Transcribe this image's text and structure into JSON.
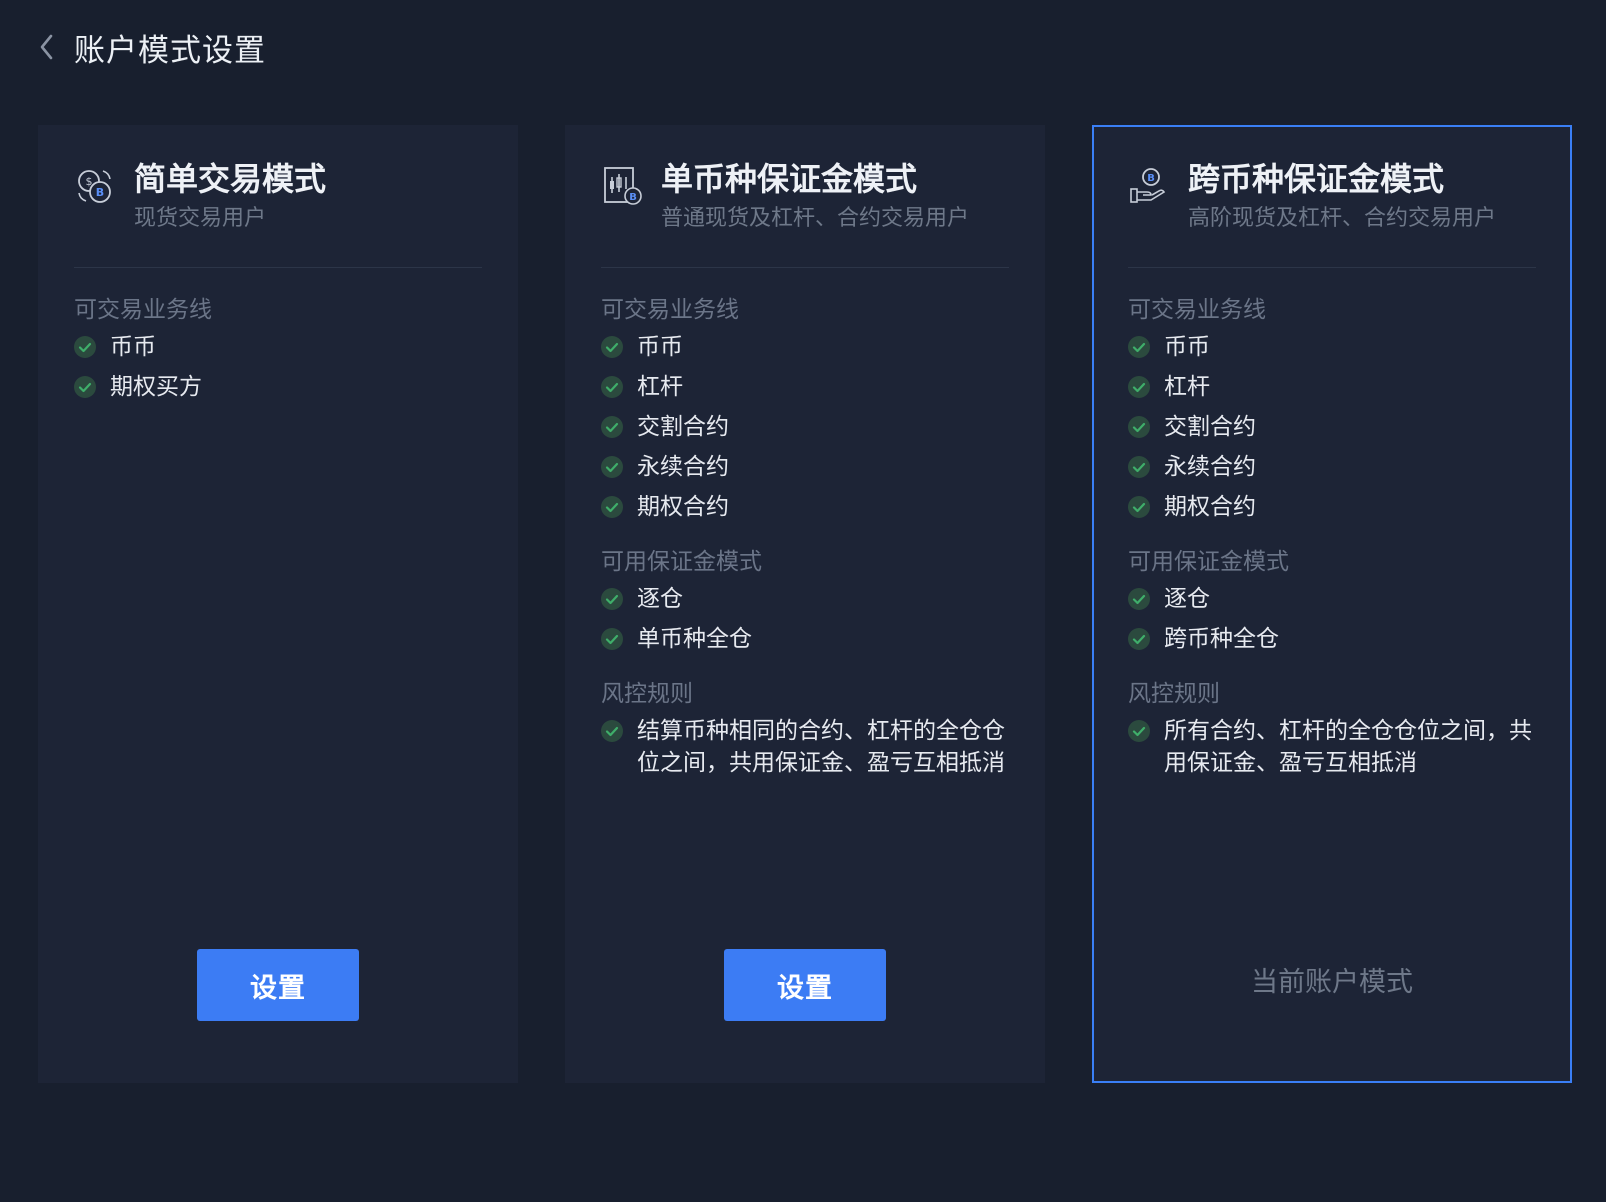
{
  "header": {
    "back_label": "返回",
    "title": "账户模式设置"
  },
  "colors": {
    "background": "#181f2e",
    "card": "#1d2436",
    "accent": "#3c7cf4",
    "check": "#3b8f5e"
  },
  "cards": [
    {
      "icon": "simple-trade-coins-icon",
      "title": "简单交易模式",
      "subtitle": "现货交易用户",
      "sections": [
        {
          "title": "可交易业务线",
          "items": [
            "币币",
            "期权买方"
          ]
        }
      ],
      "action_label": "设置",
      "current": false
    },
    {
      "icon": "single-currency-margin-chart-icon",
      "title": "单币种保证金模式",
      "subtitle": "普通现货及杠杆、合约交易用户",
      "sections": [
        {
          "title": "可交易业务线",
          "items": [
            "币币",
            "杠杆",
            "交割合约",
            "永续合约",
            "期权合约"
          ]
        },
        {
          "title": "可用保证金模式",
          "items": [
            "逐仓",
            "单币种全仓"
          ]
        },
        {
          "title": "风控规则",
          "items": [
            "结算币种相同的合约、杠杆的全仓仓位之间，共用保证金、盈亏互相抵消"
          ]
        }
      ],
      "action_label": "设置",
      "current": false
    },
    {
      "icon": "multi-currency-margin-hand-icon",
      "title": "跨币种保证金模式",
      "subtitle": "高阶现货及杠杆、合约交易用户",
      "sections": [
        {
          "title": "可交易业务线",
          "items": [
            "币币",
            "杠杆",
            "交割合约",
            "永续合约",
            "期权合约"
          ]
        },
        {
          "title": "可用保证金模式",
          "items": [
            "逐仓",
            "跨币种全仓"
          ]
        },
        {
          "title": "风控规则",
          "items": [
            "所有合约、杠杆的全仓仓位之间，共用保证金、盈亏互相抵消"
          ]
        }
      ],
      "current_label": "当前账户模式",
      "current": true
    }
  ]
}
